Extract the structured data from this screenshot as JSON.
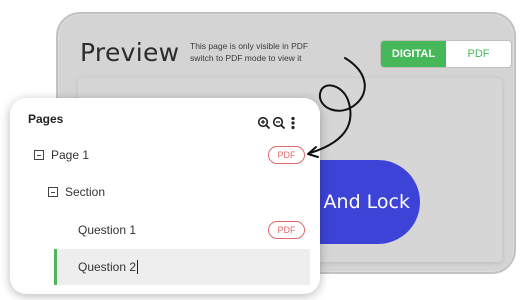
{
  "preview": {
    "title": "Preview",
    "note_line1": "This page is only visible in PDF",
    "note_line2": "switch to PDF mode to view it",
    "mode_digital": "DIGITAL",
    "mode_pdf": "PDF",
    "active_mode": "DIGITAL",
    "lock_button_label": "And Lock",
    "lock_button_color": "#3c43d6"
  },
  "pages_panel": {
    "title": "Pages",
    "tools": [
      "zoom-in-icon",
      "zoom-out-icon",
      "more-vertical-icon"
    ],
    "tree": [
      {
        "label": "Page 1",
        "badge": "PDF"
      },
      {
        "label": "Section",
        "badge": ""
      },
      {
        "label": "Question 1",
        "badge": "PDF"
      },
      {
        "label": "Question 2",
        "badge": "",
        "selected": true
      }
    ]
  },
  "colors": {
    "accent_green": "#46b85a",
    "pdf_badge_red": "#e06a6a"
  }
}
